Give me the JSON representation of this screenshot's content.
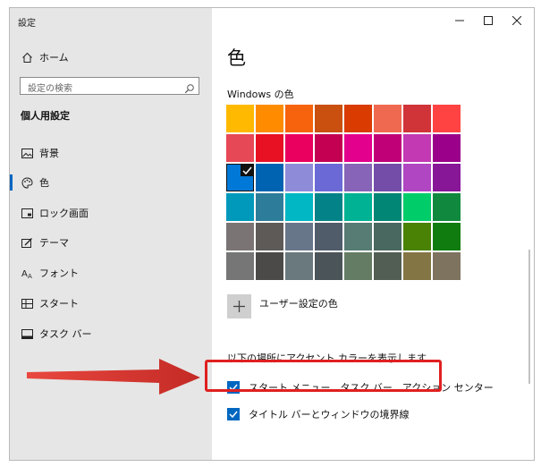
{
  "window": {
    "title": "設定",
    "controls": {
      "minimize": "–",
      "maximize": "☐",
      "close": "✕"
    }
  },
  "sidebar": {
    "home_label": "ホーム",
    "search_placeholder": "設定の検索",
    "section_title": "個人用設定",
    "items": [
      {
        "label": "背景",
        "icon": "image-icon"
      },
      {
        "label": "色",
        "icon": "palette-icon",
        "active": true
      },
      {
        "label": "ロック画面",
        "icon": "lock-screen-icon"
      },
      {
        "label": "テーマ",
        "icon": "theme-icon"
      },
      {
        "label": "フォント",
        "icon": "font-icon"
      },
      {
        "label": "スタート",
        "icon": "start-icon"
      },
      {
        "label": "タスク バー",
        "icon": "taskbar-icon"
      }
    ]
  },
  "main": {
    "page_title": "色",
    "windows_colors_label": "Windows の色",
    "selected_color": "#0078d7",
    "swatches": [
      [
        "#ffb900",
        "#ff8c00",
        "#f7630c",
        "#ca5010",
        "#da3b01",
        "#ef6950",
        "#d13438",
        "#ff4343"
      ],
      [
        "#e74856",
        "#e81123",
        "#ea005e",
        "#c30052",
        "#e3008c",
        "#bf0077",
        "#c239b3",
        "#9a0089"
      ],
      [
        "#0078d7",
        "#0063b1",
        "#8e8cd8",
        "#6b69d6",
        "#8764b8",
        "#744da9",
        "#b146c2",
        "#881798"
      ],
      [
        "#0099bc",
        "#2d7d9a",
        "#00b7c3",
        "#038387",
        "#00b294",
        "#018574",
        "#00cc6a",
        "#10893e"
      ],
      [
        "#7a7574",
        "#5d5a58",
        "#68768a",
        "#515c6b",
        "#567c73",
        "#486860",
        "#498205",
        "#107c10"
      ],
      [
        "#767676",
        "#4c4a48",
        "#69797e",
        "#4a5459",
        "#647c64",
        "#525e54",
        "#847545",
        "#7e735f"
      ]
    ],
    "custom_color_label": "ユーザー設定の色",
    "custom_color_symbol": "+",
    "accent_section_label": "以下の場所にアクセント カラーを表示します",
    "checkboxes": [
      {
        "label": "スタート メニュー、タスク バー、アクション センター",
        "checked": true
      },
      {
        "label": "タイトル バーとウィンドウの境界線",
        "checked": true
      }
    ]
  },
  "annotation": {
    "highlight_color": "#e02020",
    "arrow_color": "#d42a26"
  }
}
